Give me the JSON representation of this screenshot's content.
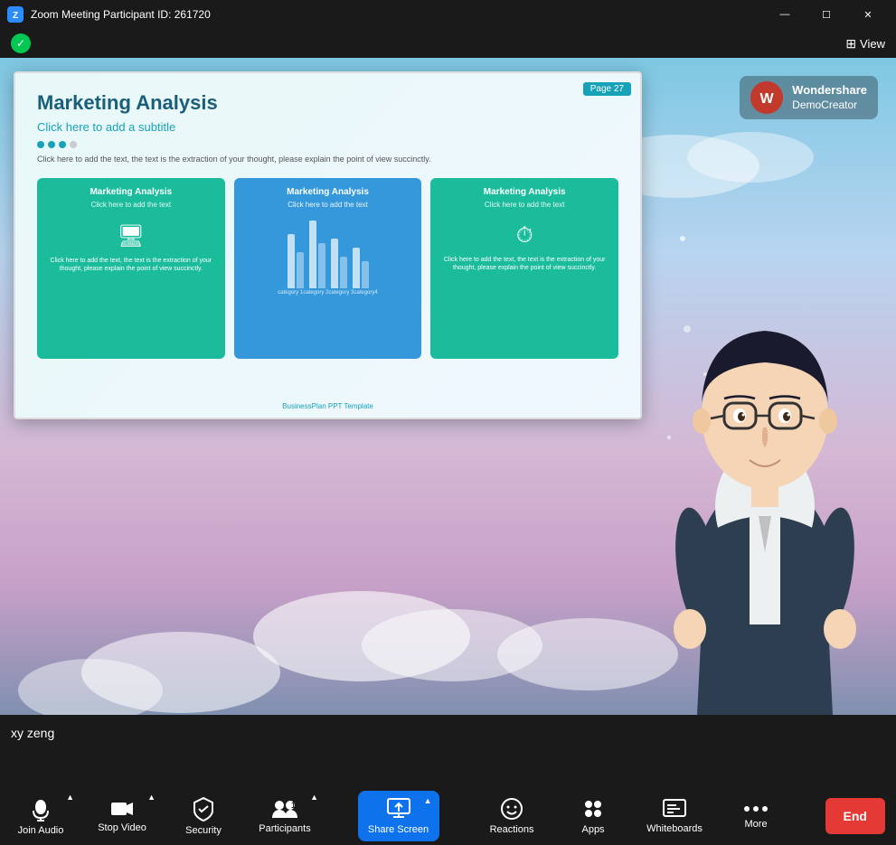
{
  "titleBar": {
    "title": "Zoom Meeting Participant ID: 261720",
    "minBtn": "—",
    "maxBtn": "☐",
    "closeBtn": "✕"
  },
  "topToolbar": {
    "shieldIcon": "✓",
    "viewLabel": "View",
    "viewIcon": "⊞"
  },
  "slide": {
    "pageBadge": "Page  27",
    "title": "Marketing Analysis",
    "subtitle": "Click here to add a subtitle",
    "description": "Click here to add the text, the text is the extraction of your thought, please explain the point of view succinctly.",
    "card1": {
      "title": "Marketing Analysis",
      "subtitle": "Click here to add the text",
      "icon": "🖥",
      "bodyText": "Click here to add the text, the text is the extraction of your thought, please explain the point of view succinctly."
    },
    "card2": {
      "title": "Marketing Analysis",
      "subtitle": "Click here to add the text",
      "categories": [
        "category 1",
        "category 2",
        "category 3",
        "category4"
      ]
    },
    "card3": {
      "title": "Marketing Analysis",
      "subtitle": "Click here to add the text",
      "icon": "⏱",
      "bodyText": "Click here to add the text, the text is the extraction of your thought, please explain the point of view succinctly."
    },
    "footer": "BusinessPlan PPT Template"
  },
  "wondershare": {
    "icon": "W",
    "line1": "Wondershare",
    "line2": "DemoCreator"
  },
  "username": "xy zeng",
  "toolbar": {
    "joinAudio": "Join Audio",
    "stopVideo": "Stop Video",
    "security": "Security",
    "participants": "Participants",
    "participantsCount": "1",
    "shareScreen": "Share Screen",
    "reactions": "Reactions",
    "apps": "Apps",
    "whiteboards": "Whiteboards",
    "more": "More",
    "end": "End"
  }
}
